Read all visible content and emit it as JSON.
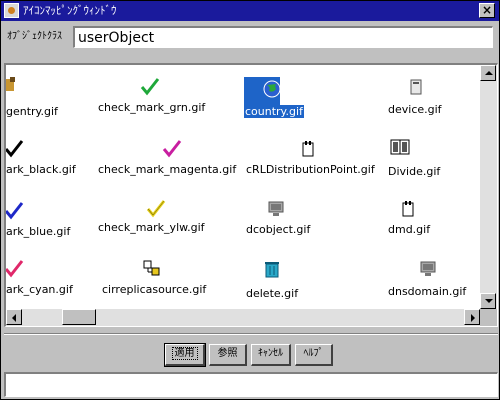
{
  "window": {
    "title": "ｱｲｺﾝﾏｯﾋﾟﾝｸﾞｳｨﾝﾄﾞｳ",
    "close_glyph": "×"
  },
  "object_class": {
    "label": "ｵﾌﾞｼﾞｪｸﾄｸﾗｽ",
    "value": "userObject"
  },
  "icons": [
    {
      "label": "gentry.gif",
      "icon": "gentry-icon"
    },
    {
      "label": "check_mark_grn.gif",
      "icon": "check-mark-green-icon",
      "color": "#1fa83a"
    },
    {
      "label": "country.gif",
      "icon": "globe-icon",
      "selected": true
    },
    {
      "label": "device.gif",
      "icon": "device-icon"
    },
    {
      "label": "ark_black.gif",
      "icon": "check-mark-black-icon",
      "color": "#000000"
    },
    {
      "label": "check_mark_magenta.gif",
      "icon": "check-mark-magenta-icon",
      "color": "#c81ea0"
    },
    {
      "label": "cRLDistributionPoint.gif",
      "icon": "document-icon"
    },
    {
      "label": "Divide.gif",
      "icon": "divide-icon"
    },
    {
      "label": "ark_blue.gif",
      "icon": "check-mark-blue-icon",
      "color": "#1e28c8"
    },
    {
      "label": "check_mark_ylw.gif",
      "icon": "check-mark-yellow-icon",
      "color": "#e6d21e"
    },
    {
      "label": "dcobject.gif",
      "icon": "monitor-icon"
    },
    {
      "label": "dmd.gif",
      "icon": "document-icon"
    },
    {
      "label": "ark_cyan.gif",
      "icon": "check-mark-pink-icon",
      "color": "#e0286a"
    },
    {
      "label": "cirreplicasource.gif",
      "icon": "replica-icon"
    },
    {
      "label": "delete.gif",
      "icon": "trash-icon"
    },
    {
      "label": "dnsdomain.gif",
      "icon": "monitor-icon"
    }
  ],
  "buttons": {
    "apply": "適用",
    "browse": "参照",
    "cancel": "ｷｬﾝｾﾙ",
    "help": "ﾍﾙﾌﾟ"
  },
  "status": "",
  "colors": {
    "title_bar": "#1a1a9c",
    "selection": "#1e64c8",
    "window_bg": "#c0c0c0"
  }
}
